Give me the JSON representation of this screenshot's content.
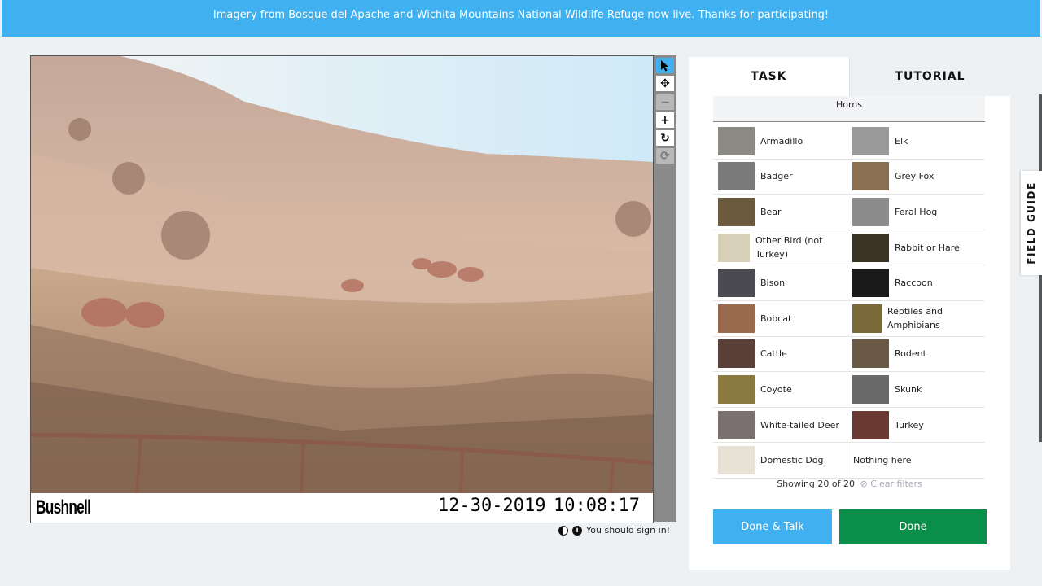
{
  "banner": {
    "text": "Imagery from Bosque del Apache and Wichita Mountains National Wildlife Refuge now live. Thanks for participating!"
  },
  "image": {
    "brand": "Bushnell",
    "date": "12-30-2019",
    "time": "10:08:17"
  },
  "toolbar": {
    "icons": [
      "pointer-icon",
      "move-icon",
      "zoom-out-icon",
      "zoom-in-icon",
      "rotate-icon",
      "reset-icon"
    ],
    "glyphs": {
      "move": "✥",
      "zoom_out": "−",
      "zoom_in": "+",
      "rotate": "↻",
      "reset": "⟳"
    }
  },
  "viewer_footer": {
    "sign_in_text": "You should sign in!",
    "info_glyph": "i"
  },
  "tabs": {
    "task": "TASK",
    "tutorial": "TUTORIAL"
  },
  "filter": {
    "label": "Horns"
  },
  "species": [
    {
      "name": "Armadillo",
      "color": "#8a8a82"
    },
    {
      "name": "Elk",
      "color": "#9a9a9a"
    },
    {
      "name": "Badger",
      "color": "#7a7a7a"
    },
    {
      "name": "Grey Fox",
      "color": "#8a7050"
    },
    {
      "name": "Bear",
      "color": "#6b5a3e"
    },
    {
      "name": "Feral Hog",
      "color": "#8c8c8c"
    },
    {
      "name": "Other Bird (not Turkey)",
      "color": "#d8cfb8"
    },
    {
      "name": "Rabbit or Hare",
      "color": "#3a3222"
    },
    {
      "name": "Bison",
      "color": "#4a4a50"
    },
    {
      "name": "Raccoon",
      "color": "#1a1a1a"
    },
    {
      "name": "Bobcat",
      "color": "#9a6a4e"
    },
    {
      "name": "Reptiles and Amphibians",
      "color": "#7a6a3a"
    },
    {
      "name": "Cattle",
      "color": "#5a3e38"
    },
    {
      "name": "Rodent",
      "color": "#6a5a45"
    },
    {
      "name": "Coyote",
      "color": "#8a7a40"
    },
    {
      "name": "Skunk",
      "color": "#6a6a6a"
    },
    {
      "name": "White-tailed Deer",
      "color": "#7a7070"
    },
    {
      "name": "Turkey",
      "color": "#6a3a32"
    },
    {
      "name": "Domestic Dog",
      "color": "#e8e2d6"
    },
    {
      "name": "Nothing here",
      "color": ""
    }
  ],
  "status": {
    "showing": "Showing 20 of 20",
    "clear_filters": "Clear filters"
  },
  "buttons": {
    "done_talk": "Done & Talk",
    "done": "Done"
  },
  "field_guide": {
    "label": "FIELD GUIDE"
  },
  "colors": {
    "accent": "#3fb0f0",
    "done": "#0a8f4a",
    "background": "#eef1f4"
  }
}
